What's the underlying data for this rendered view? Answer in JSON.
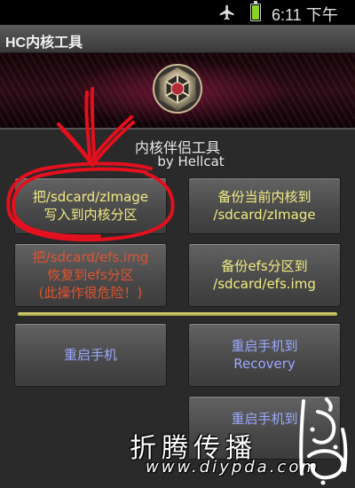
{
  "status_bar": {
    "time": "6:11 下午",
    "icons": [
      "airplane-icon",
      "battery-icon"
    ],
    "battery_color": "#8bd12a"
  },
  "app": {
    "title": "HC内核工具"
  },
  "info": {
    "line1": "内核伴侣工具",
    "line2": "by Hellcat"
  },
  "buttons": {
    "flash_zimage": {
      "line1": "把/sdcard/zImage",
      "line2": "写入到内核分区"
    },
    "backup_kernel": {
      "line1": "备份当前内核到",
      "line2": "/sdcard/zImage"
    },
    "restore_efs": {
      "line1": "把/sdcard/efs.img",
      "line2": "恢复到efs分区",
      "line3": "(此操作很危险！)"
    },
    "backup_efs": {
      "line1": "备份efs分区到",
      "line2": "/sdcard/efs.img"
    },
    "reboot": {
      "line1": "重启手机"
    },
    "reboot_recovery": {
      "line1": "重启手机到",
      "line2": "Recovery"
    },
    "reboot_download": {
      "line1": "重启手机到"
    }
  },
  "watermark": {
    "chinese": "折腾传播",
    "url": "www.diypda.com"
  },
  "colors": {
    "yellow_text": "#f1ec82",
    "red_text": "#e05430",
    "blue_text": "#9aa8ff",
    "divider": "#e9e27a",
    "annotation_red": "#e3101e"
  }
}
